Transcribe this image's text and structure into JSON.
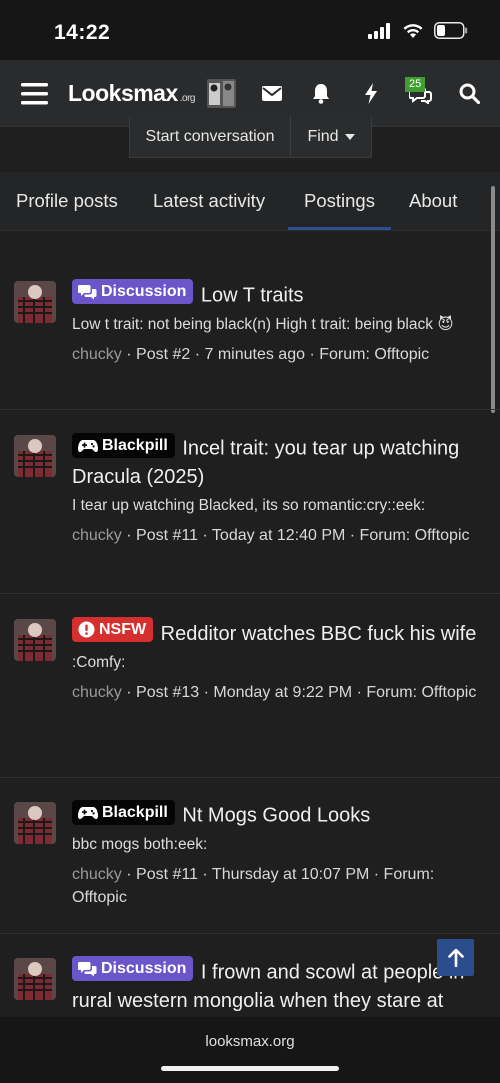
{
  "status": {
    "time": "14:22"
  },
  "nav": {
    "logo": "Looksmax",
    "logo_suffix": ".org",
    "notification_count": "25"
  },
  "subbar": {
    "start_conversation": "Start conversation",
    "find": "Find"
  },
  "tabs": [
    {
      "label": "Profile posts"
    },
    {
      "label": "Latest activity"
    },
    {
      "label": "Postings"
    },
    {
      "label": "About"
    }
  ],
  "active_tab": "Postings",
  "posts": [
    {
      "prefix": "Discussion",
      "title": "Low T traits",
      "snippet": "Low t trait: not being black(n) High t trait: being black",
      "emoji": "😈",
      "user": "chucky",
      "meta": " · Post #2 · 7 minutes ago · Forum: Offtopic"
    },
    {
      "prefix": "Blackpill",
      "title": "Incel trait: you tear up watching Dracula (2025)",
      "snippet": "I tear up watching Blacked, its so romantic:cry::eek:",
      "user": "chucky",
      "meta": " · Post #11 · Today at 12:40 PM · Forum: Offtopic"
    },
    {
      "prefix": "NSFW",
      "title": "Redditor watches BBC fuck his wife",
      "snippet": ":Comfy:",
      "user": "chucky",
      "meta": " · Post #13 · Monday at 9:22 PM · Forum: Offtopic"
    },
    {
      "prefix": "Blackpill",
      "title": "Nt Mogs Good Looks",
      "snippet": "bbc mogs both:eek:",
      "user": "chucky",
      "meta": " · Post #11 · Thursday at 10:07 PM · Forum: Offtopic"
    },
    {
      "prefix": "Discussion",
      "title": "I frown and scowl at people in rural western mongolia when they stare at"
    }
  ],
  "browser": {
    "url": "looksmax.org"
  },
  "colors": {
    "prefix_discussion": "#6a55c9",
    "prefix_blackpill": "#050505",
    "prefix_nsfw": "#d62f2f",
    "active_tab_underline": "#2f4e8f",
    "scroll_top_button": "#2c4d8c"
  }
}
